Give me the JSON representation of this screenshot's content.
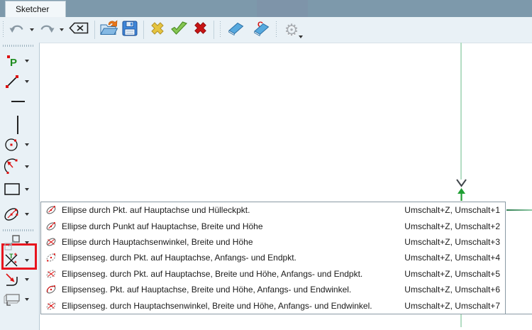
{
  "tab": {
    "label": "Sketcher"
  },
  "top_toolbar": {
    "items": [
      {
        "icon": "undo-icon",
        "dropdown": true
      },
      {
        "icon": "redo-icon",
        "dropdown": true
      },
      {
        "icon": "backspace-icon",
        "dropdown": false
      },
      {
        "icon": "open-file-icon",
        "dropdown": false
      },
      {
        "icon": "save-icon",
        "dropdown": false
      },
      {
        "icon": "cancel-yellow-cross-icon",
        "dropdown": false
      },
      {
        "icon": "validate-green-check-icon",
        "dropdown": false
      },
      {
        "icon": "delete-red-cross-icon",
        "dropdown": false
      },
      {
        "icon": "eraser-icon",
        "dropdown": false
      },
      {
        "icon": "eraser-constraints-icon",
        "dropdown": false
      },
      {
        "icon": "settings-gear-icon",
        "dropdown": true
      }
    ]
  },
  "left_toolbar": {
    "tools": [
      {
        "icon": "point-tool-icon",
        "dropdown": true
      },
      {
        "icon": "line-tool-icon",
        "dropdown": true
      },
      {
        "icon": "separator-horizontal",
        "dropdown": false
      },
      {
        "icon": "separator-vertical",
        "dropdown": false
      },
      {
        "icon": "circle-tool-icon",
        "dropdown": true
      },
      {
        "icon": "arc-tool-icon",
        "dropdown": true
      },
      {
        "icon": "rectangle-tool-icon",
        "dropdown": true
      },
      {
        "icon": "ellipse-tool-icon",
        "dropdown": true,
        "highlighted": true
      },
      {
        "icon": "move-tool-icon",
        "dropdown": true
      },
      {
        "icon": "trim-tool-icon",
        "dropdown": true
      },
      {
        "icon": "fillet-tool-icon",
        "dropdown": true
      },
      {
        "icon": "external-geometry-tool-icon",
        "dropdown": true
      }
    ]
  },
  "menu": {
    "items": [
      {
        "icon": "ellipse-endpoint-icon",
        "label": "Ellipse durch Pkt. auf Hauptachse und Hülleckpkt.",
        "shortcut": "Umschalt+Z, Umschalt+1"
      },
      {
        "icon": "ellipse-width-height-icon",
        "label": "Ellipse durch Punkt auf Hauptachse, Breite und Höhe",
        "shortcut": "Umschalt+Z, Umschalt+2"
      },
      {
        "icon": "ellipse-angle-icon",
        "label": "Ellipse durch Hauptachsenwinkel, Breite und Höhe",
        "shortcut": "Umschalt+Z, Umschalt+3"
      },
      {
        "icon": "ellipse-segment-endpoints-icon",
        "label": "Ellipsenseg. durch Pkt. auf Hauptachse, Anfangs- und Endpkt.",
        "shortcut": "Umschalt+Z, Umschalt+4"
      },
      {
        "icon": "ellipse-segment-width-height-icon",
        "label": "Ellipsenseg. durch Pkt. auf Hauptachse, Breite und Höhe, Anfangs- und Endpkt.",
        "shortcut": "Umschalt+Z, Umschalt+5"
      },
      {
        "icon": "ellipse-segment-angles-icon",
        "label": "Ellipsenseg. Pkt. auf Hauptachse, Breite und Höhe, Anfangs- und Endwinkel.",
        "shortcut": "Umschalt+Z, Umschalt+6"
      },
      {
        "icon": "ellipse-segment-axis-angle-icon",
        "label": "Ellipsenseg. durch Hauptachsenwinkel, Breite und Höhe, Anfangs- und Endwinkel.",
        "shortcut": "Umschalt+Z, Umschalt+7"
      }
    ]
  },
  "colors": {
    "tabbar_bg": "#7d99ab",
    "toolbar_bg": "#e9f1f6",
    "highlight_red": "#e8141e",
    "axis_green_light": "#b4ddc4",
    "axis_green_arrow": "#1f9e33",
    "menu_border": "#8a9aa4"
  }
}
